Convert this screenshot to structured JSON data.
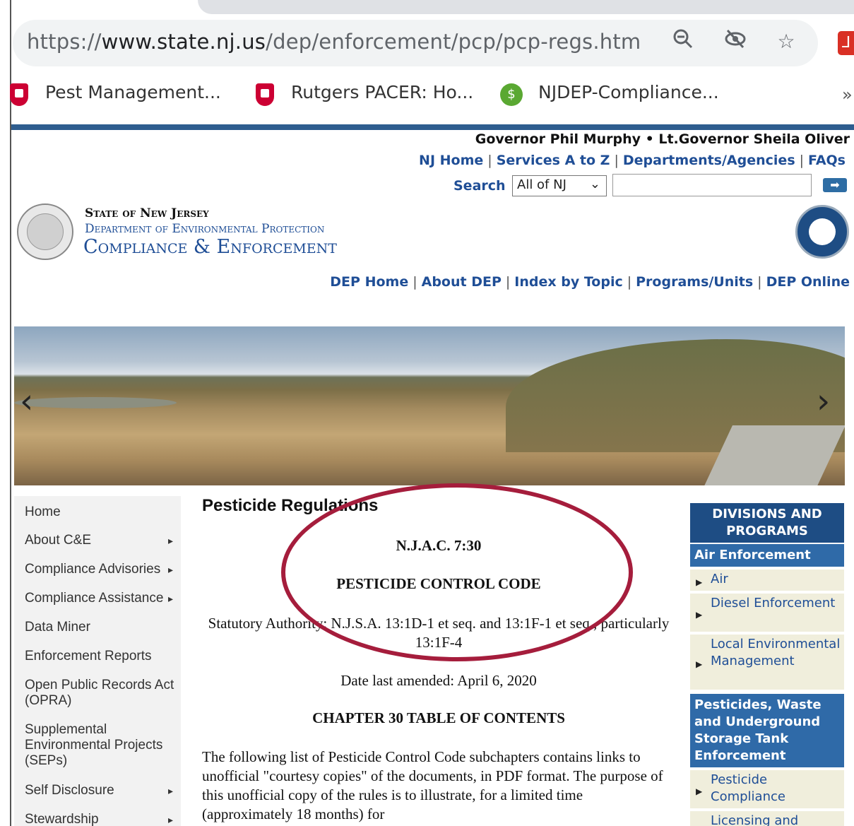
{
  "browser": {
    "url_prefix": "https://",
    "url_host": "www.state.nj.us",
    "url_path": "/dep/enforcement/pcp/pcp-regs.htm",
    "icons": [
      "zoom-icon",
      "eye-off-icon",
      "star-icon",
      "pdf-extension-icon"
    ],
    "bookmarks": [
      {
        "label": "Pest Management...",
        "icon": "rutgers-shield-icon"
      },
      {
        "label": "Rutgers PACER: Ho...",
        "icon": "rutgers-shield-icon"
      },
      {
        "label": "NJDEP-Compliance...",
        "icon": "nj-icon"
      }
    ],
    "more": "»"
  },
  "header": {
    "governor_line": "Governor Phil Murphy • Lt.Governor Sheila Oliver",
    "nj_links": [
      "NJ Home",
      "Services A to Z",
      "Departments/Agencies",
      "FAQs"
    ],
    "search_label": "Search",
    "search_scope": "All of NJ",
    "search_go": "➡",
    "title_line1": "State of New Jersey",
    "title_line2": "Department of Environmental Protection",
    "title_line3": "Compliance & Enforcement",
    "dep_links": [
      "DEP Home",
      "About DEP",
      "Index by Topic",
      "Programs/Units",
      "DEP Online"
    ]
  },
  "carousel": {
    "prev": "‹",
    "next": "›"
  },
  "leftnav": {
    "items": [
      {
        "label": "Home",
        "arrow": ""
      },
      {
        "label": "About C&E",
        "arrow": "▸"
      },
      {
        "label": "Compliance Advisories",
        "arrow": "▸"
      },
      {
        "label": "Compliance Assistance",
        "arrow": "▸"
      },
      {
        "label": "Data Miner",
        "arrow": ""
      },
      {
        "label": "Enforcement Reports",
        "arrow": ""
      },
      {
        "label": "Open Public Records Act (OPRA)",
        "arrow": ""
      },
      {
        "label": "Supplemental Environmental Projects (SEPs)",
        "arrow": ""
      },
      {
        "label": "Self Disclosure",
        "arrow": "▸"
      },
      {
        "label": "Stewardship",
        "arrow": "▸"
      }
    ]
  },
  "main": {
    "heading": "Pesticide Regulations",
    "njac": "N.J.A.C. 7:30",
    "code_title": "PESTICIDE CONTROL CODE",
    "authority": "Statutory Authority: N.J.S.A. 13:1D-1 et seq. and 13:1F-1 et seq., particularly 13:1F-4",
    "date_amended": "Date last amended: April 6, 2020",
    "toc_heading": "CHAPTER 30   TABLE OF CONTENTS",
    "intro_paragraph": "The following list of Pesticide Control Code subchapters contains links to unofficial \"courtesy copies\" of the documents, in PDF format. The purpose of this unofficial copy of the rules is to illustrate, for a limited time (approximately 18 months) for"
  },
  "rightnav": {
    "heading": "DIVISIONS AND PROGRAMS",
    "cat1": "Air Enforcement",
    "items1": [
      "Air",
      "Diesel Enforcement",
      "Local Environmental Management"
    ],
    "cat2": "Pesticides, Waste and Underground Storage Tank Enforcement",
    "items2": [
      "Pesticide Compliance",
      "Licensing and"
    ]
  },
  "colors": {
    "accent": "#1f4e96",
    "highlight": "#a51d3c",
    "nav_head": "#1e4d84"
  }
}
